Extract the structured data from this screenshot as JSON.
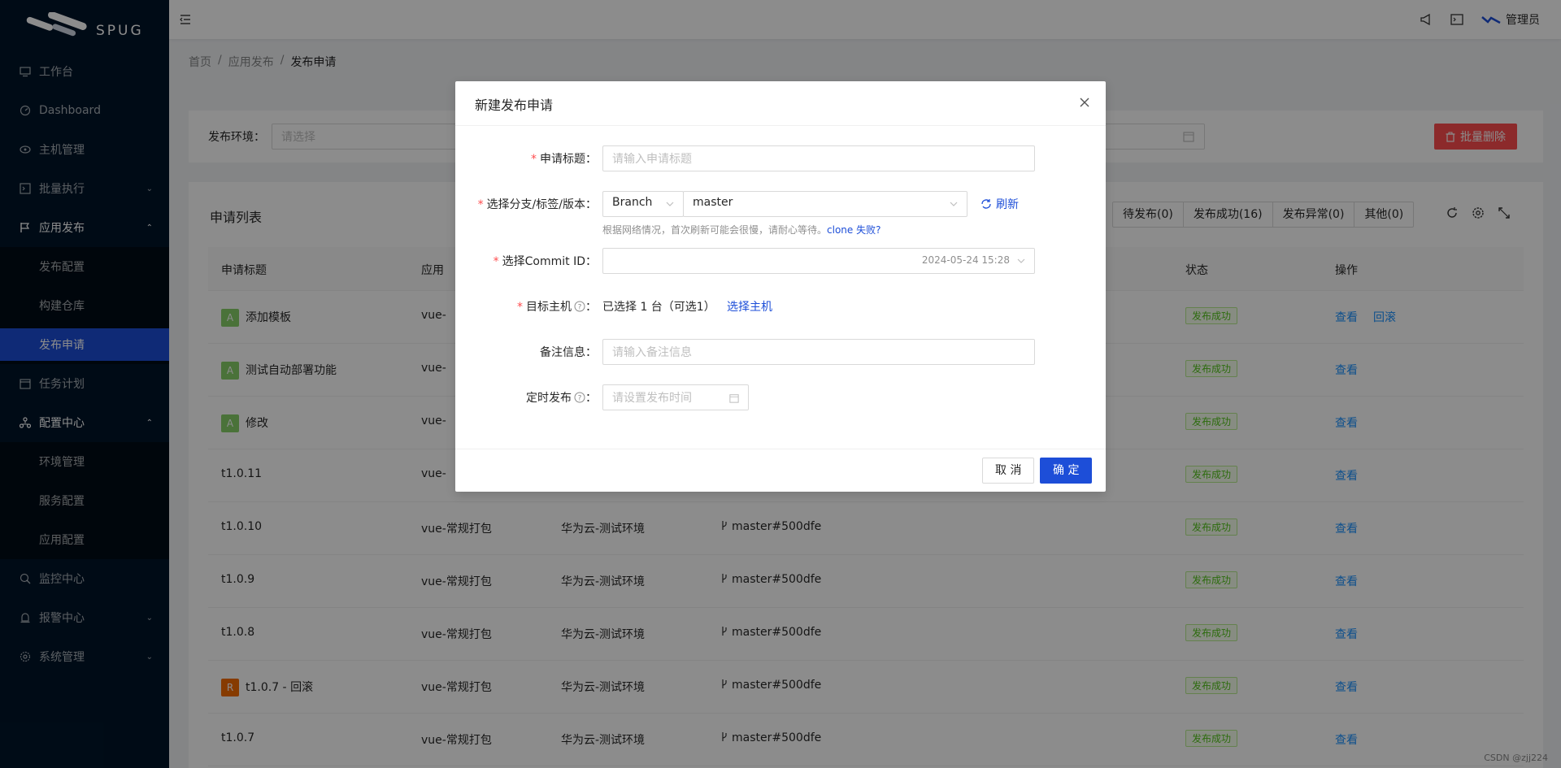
{
  "app": {
    "logo_text": "SPUG"
  },
  "sidebar": {
    "items": [
      {
        "label": "工作台",
        "icon": "desktop-icon"
      },
      {
        "label": "Dashboard",
        "icon": "dashboard-icon"
      },
      {
        "label": "主机管理",
        "icon": "cloud-server-icon"
      },
      {
        "label": "批量执行",
        "icon": "code-icon"
      },
      {
        "label": "应用发布",
        "icon": "flag-icon"
      },
      {
        "label": "发布配置"
      },
      {
        "label": "构建仓库"
      },
      {
        "label": "发布申请"
      },
      {
        "label": "任务计划",
        "icon": "schedule-icon"
      },
      {
        "label": "配置中心",
        "icon": "deployment-unit-icon"
      },
      {
        "label": "环境管理"
      },
      {
        "label": "服务配置"
      },
      {
        "label": "应用配置"
      },
      {
        "label": "监控中心",
        "icon": "monitor-icon"
      },
      {
        "label": "报警中心",
        "icon": "alert-icon"
      },
      {
        "label": "系统管理",
        "icon": "setting-icon"
      }
    ]
  },
  "header": {
    "user": "管理员"
  },
  "breadcrumb": [
    "首页",
    "应用发布",
    "发布申请"
  ],
  "filter": {
    "env_label": "发布环境：",
    "env_placeholder": "请选择",
    "batch_delete": "批量删除"
  },
  "list": {
    "title": "申请列表",
    "tabs": [
      "待发布(0)",
      "发布成功(16)",
      "发布异常(0)",
      "其他(0)"
    ],
    "columns": [
      "申请标题",
      "应用",
      "状态",
      "操作"
    ],
    "rows": [
      {
        "badge": "A",
        "title": "添加模板",
        "app": "vue-",
        "env": "",
        "ver": "",
        "status": "发布成功",
        "actions": [
          "查看",
          "回滚"
        ]
      },
      {
        "badge": "A",
        "title": "测试自动部署功能",
        "app": "vue-",
        "env": "",
        "ver": "",
        "status": "发布成功",
        "actions": [
          "查看"
        ]
      },
      {
        "badge": "A",
        "title": "修改",
        "app": "vue-",
        "env": "",
        "ver": "",
        "status": "发布成功",
        "actions": [
          "查看"
        ]
      },
      {
        "badge": "",
        "title": "t1.0.11",
        "app": "vue-",
        "env": "",
        "ver": "",
        "status": "发布成功",
        "actions": [
          "查看"
        ]
      },
      {
        "badge": "",
        "title": "t1.0.10",
        "app": "vue-常规打包",
        "env": "华为云-测试环境",
        "ver": "master#500dfe",
        "status": "发布成功",
        "actions": [
          "查看"
        ]
      },
      {
        "badge": "",
        "title": "t1.0.9",
        "app": "vue-常规打包",
        "env": "华为云-测试环境",
        "ver": "master#500dfe",
        "status": "发布成功",
        "actions": [
          "查看"
        ]
      },
      {
        "badge": "",
        "title": "t1.0.8",
        "app": "vue-常规打包",
        "env": "华为云-测试环境",
        "ver": "master#500dfe",
        "status": "发布成功",
        "actions": [
          "查看"
        ]
      },
      {
        "badge": "R",
        "title": "t1.0.7 - 回滚",
        "app": "vue-常规打包",
        "env": "华为云-测试环境",
        "ver": "master#500dfe",
        "status": "发布成功",
        "actions": [
          "查看"
        ]
      },
      {
        "badge": "",
        "title": "t1.0.7",
        "app": "vue-常规打包",
        "env": "华为云-测试环境",
        "ver": "master#500dfe",
        "status": "发布成功",
        "actions": [
          "查看"
        ]
      }
    ]
  },
  "modal": {
    "title": "新建发布申请",
    "title_label": "申请标题",
    "title_placeholder": "请输入申请标题",
    "branch_label": "选择分支/标签/版本",
    "branch_type": "Branch",
    "branch_value": "master",
    "refresh": "刷新",
    "hint": "根据网络情况，首次刷新可能会很慢，请耐心等待。",
    "hint_link": "clone 失败?",
    "commit_label": "选择Commit ID",
    "commit_value": "2024-05-24 15:28",
    "host_label": "目标主机",
    "host_value": "已选择 1 台（可选1）",
    "host_link": "选择主机",
    "remark_label": "备注信息",
    "remark_placeholder": "请输入备注信息",
    "schedule_label": "定时发布",
    "schedule_placeholder": "请设置发布时间",
    "cancel": "取 消",
    "ok": "确 定"
  },
  "watermark": "CSDN @zjj224"
}
